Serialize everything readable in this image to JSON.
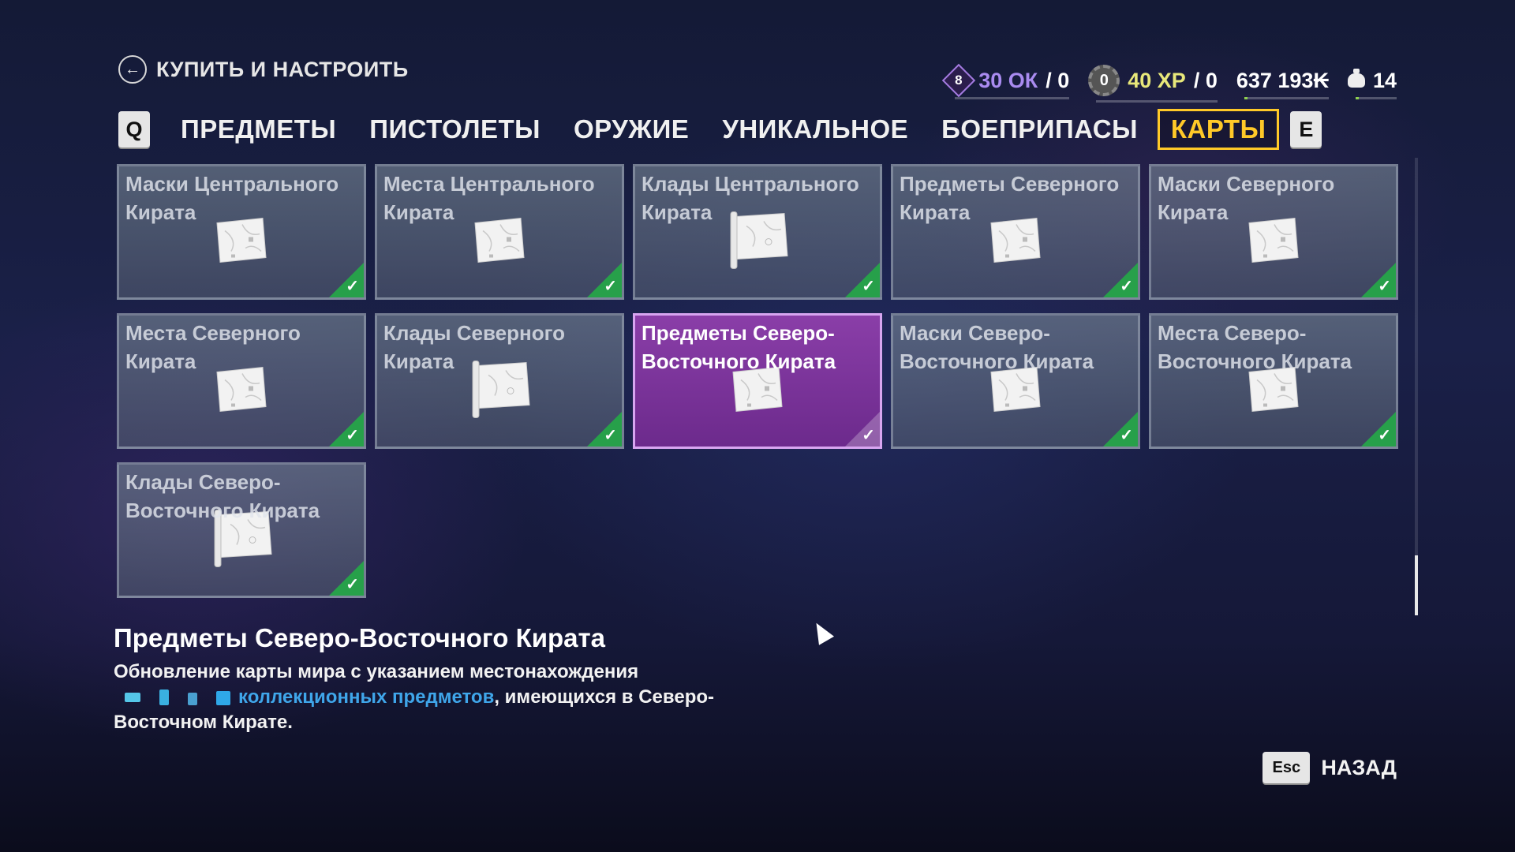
{
  "header": {
    "title": "КУПИТЬ И НАСТРОИТЬ"
  },
  "stats": {
    "skill_level": "8",
    "skill_points": "30 ОК",
    "skill_points_suffix": "/ 0",
    "rank": "0",
    "xp": "40 XP",
    "xp_suffix": "/ 0",
    "money": "637 193₭",
    "loot": "14"
  },
  "tabs": {
    "prev_key": "Q",
    "next_key": "E",
    "items": [
      "ПРЕДМЕТЫ",
      "ПИСТОЛЕТЫ",
      "ОРУЖИЕ",
      "УНИКАЛЬНОЕ",
      "БОЕПРИПАСЫ",
      "КАРТЫ"
    ],
    "active": "КАРТЫ"
  },
  "cards": [
    {
      "title": "Маски Центрального Кирата",
      "icon": "map-icon",
      "owned": true
    },
    {
      "title": "Места Центрального Кирата",
      "icon": "map-icon",
      "owned": true
    },
    {
      "title": "Клады Центрального Кирата",
      "icon": "scroll-map-icon",
      "owned": true
    },
    {
      "title": "Предметы Северного Кирата",
      "icon": "map-icon",
      "owned": true
    },
    {
      "title": "Маски Северного Кирата",
      "icon": "map-icon",
      "owned": true
    },
    {
      "title": "Места Северного Кирата",
      "icon": "map-icon",
      "owned": true
    },
    {
      "title": "Клады Северного Кирата",
      "icon": "scroll-map-icon",
      "owned": true
    },
    {
      "title": "Предметы Северо-Восточного Кирата",
      "icon": "map-icon",
      "owned": true,
      "selected": true
    },
    {
      "title": "Маски Северо-Восточного Кирата",
      "icon": "map-icon",
      "owned": true
    },
    {
      "title": "Места Северо-Восточного Кирата",
      "icon": "map-icon",
      "owned": true
    },
    {
      "title": "Клады Северо-Восточного Кирата",
      "icon": "scroll-map-icon",
      "owned": true
    }
  ],
  "detail": {
    "title": "Предметы Северо-Восточного Кирата",
    "line1": "Обновление карты мира с указанием местонахождения",
    "link": "коллекционных предметов",
    "after_link": ", имеющихся в Северо-",
    "line3": "Восточном Кирате."
  },
  "footer": {
    "esc_key": "Esc",
    "back_label": "НАЗАД"
  },
  "colors": {
    "active_tab": "#ffc928",
    "owned_check": "#27a04a",
    "selected_card": "#7a34a0",
    "link": "#3fa6ea"
  }
}
